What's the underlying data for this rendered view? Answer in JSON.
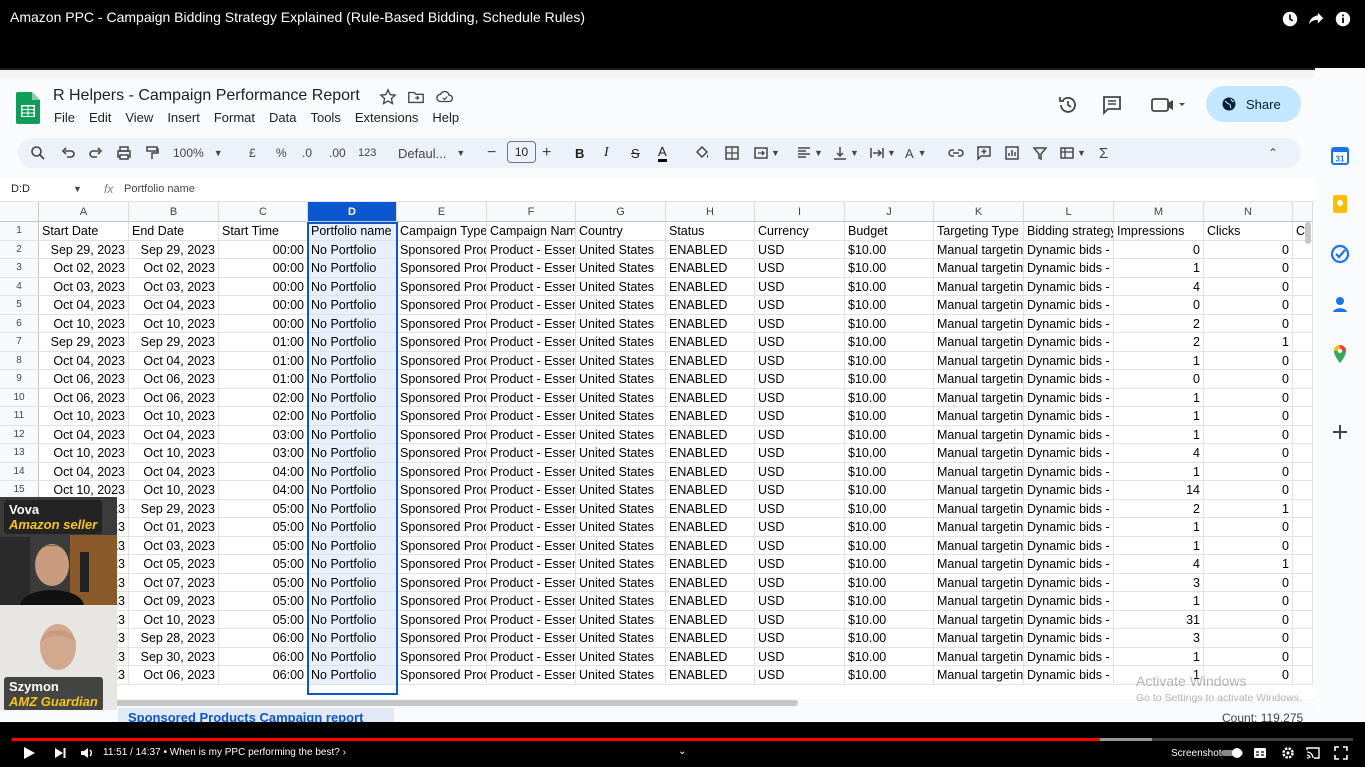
{
  "video": {
    "title": "Amazon PPC - Campaign Bidding Strategy Explained (Rule-Based Bidding, Schedule Rules)",
    "time": "11:51 / 14:37",
    "chapter": "• When is my PPC performing the best? ›",
    "screenshot_label": "Screenshot",
    "progress": 0.811,
    "buffered": 0.85
  },
  "doc": {
    "title": "R Helpers - Campaign Performance Report",
    "menus": [
      "File",
      "Edit",
      "View",
      "Insert",
      "Format",
      "Data",
      "Tools",
      "Extensions",
      "Help"
    ],
    "share_label": "Share"
  },
  "toolbar": {
    "zoom": "100%",
    "currency": "£",
    "percent": "%",
    "dec_less": ".0",
    "dec_more": ".00",
    "num_format": "123",
    "font": "Defaul...",
    "font_size": "10"
  },
  "formula": {
    "namebox": "D:D",
    "fx": "fx",
    "value": "Portfolio name"
  },
  "sheet": {
    "columns": [
      "A",
      "B",
      "C",
      "D",
      "E",
      "F",
      "G",
      "H",
      "I",
      "J",
      "K",
      "L",
      "M",
      "N"
    ],
    "headers": [
      "Start Date",
      "End Date",
      "Start Time",
      "Portfolio name",
      "Campaign Type",
      "Campaign Name",
      "Country",
      "Status",
      "Currency",
      "Budget",
      "Targeting Type",
      "Bidding strategy",
      "Impressions",
      "Clicks",
      "C"
    ],
    "rows": [
      [
        "Sep 29, 2023",
        "Sep 29, 2023",
        "00:00",
        "0",
        "0"
      ],
      [
        "Oct 02, 2023",
        "Oct 02, 2023",
        "00:00",
        "1",
        "0"
      ],
      [
        "Oct 03, 2023",
        "Oct 03, 2023",
        "00:00",
        "4",
        "0"
      ],
      [
        "Oct 04, 2023",
        "Oct 04, 2023",
        "00:00",
        "0",
        "0"
      ],
      [
        "Oct 10, 2023",
        "Oct 10, 2023",
        "00:00",
        "2",
        "0"
      ],
      [
        "Sep 29, 2023",
        "Sep 29, 2023",
        "01:00",
        "2",
        "1"
      ],
      [
        "Oct 04, 2023",
        "Oct 04, 2023",
        "01:00",
        "1",
        "0"
      ],
      [
        "Oct 06, 2023",
        "Oct 06, 2023",
        "01:00",
        "0",
        "0"
      ],
      [
        "Oct 06, 2023",
        "Oct 06, 2023",
        "02:00",
        "1",
        "0"
      ],
      [
        "Oct 10, 2023",
        "Oct 10, 2023",
        "02:00",
        "1",
        "0"
      ],
      [
        "Oct 04, 2023",
        "Oct 04, 2023",
        "03:00",
        "1",
        "0"
      ],
      [
        "Oct 10, 2023",
        "Oct 10, 2023",
        "03:00",
        "4",
        "0"
      ],
      [
        "Oct 04, 2023",
        "Oct 04, 2023",
        "04:00",
        "1",
        "0"
      ],
      [
        "Oct 10, 2023",
        "Oct 10, 2023",
        "04:00",
        "14",
        "0"
      ],
      [
        "Sep 29, 2023",
        "Sep 29, 2023",
        "05:00",
        "2",
        "1"
      ],
      [
        "23",
        "Oct 01, 2023",
        "05:00",
        "1",
        "0"
      ],
      [
        "23",
        "Oct 03, 2023",
        "05:00",
        "1",
        "0"
      ],
      [
        "23",
        "Oct 05, 2023",
        "05:00",
        "4",
        "1"
      ],
      [
        "23",
        "Oct 07, 2023",
        "05:00",
        "3",
        "0"
      ],
      [
        "23",
        "Oct 09, 2023",
        "05:00",
        "1",
        "0"
      ],
      [
        "23",
        "Oct 10, 2023",
        "05:00",
        "31",
        "0"
      ],
      [
        "23",
        "Sep 28, 2023",
        "06:00",
        "3",
        "0"
      ],
      [
        "23",
        "Sep 30, 2023",
        "06:00",
        "1",
        "0"
      ],
      [
        "23",
        "Oct 06, 2023",
        "06:00",
        "1",
        "0"
      ]
    ],
    "common": {
      "portfolio": "No Portfolio",
      "campaign_type": "Sponsored Prod",
      "campaign_name": "Product - Essent",
      "country": "United States",
      "status": "ENABLED",
      "currency": "USD",
      "budget": "$10.00",
      "targeting": "Manual targeting",
      "bidding": "Dynamic bids - d"
    },
    "tab_name": "Sponsored Products Campaign report",
    "count": "Count: 119,275"
  },
  "activate": {
    "title": "Activate Windows",
    "sub": "Go to Settings to activate Windows."
  },
  "cams": {
    "top": {
      "name": "Vova",
      "role": "Amazon seller"
    },
    "bottom": {
      "name": "Szymon",
      "role": "AMZ Guardian"
    }
  },
  "colors": {
    "selection": "#0b57d0",
    "selection_fill": "#e8f0fe",
    "share_bg": "#c2e7ff",
    "progress": "#ff0000"
  }
}
